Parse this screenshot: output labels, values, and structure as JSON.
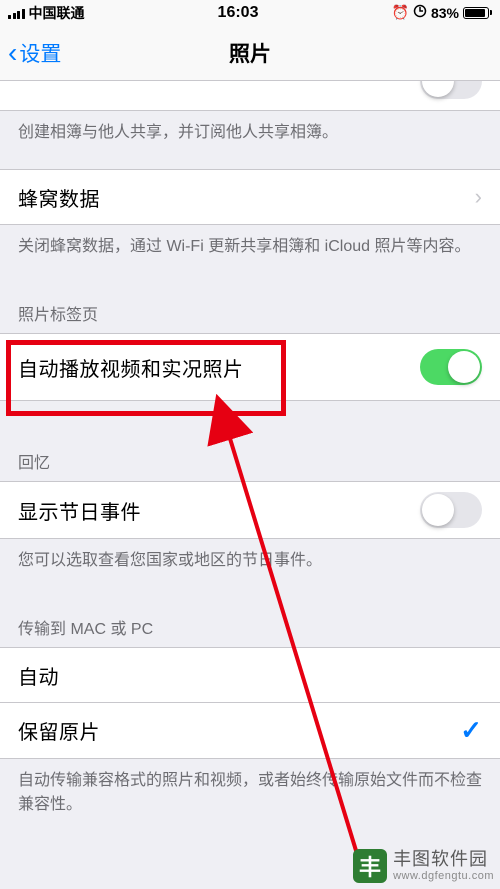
{
  "statusBar": {
    "carrier": "中国联通",
    "time": "16:03",
    "alarmIcon": "⏰",
    "rotationLockIcon": "⊕",
    "batteryPct": "83%"
  },
  "nav": {
    "back": "设置",
    "title": "照片"
  },
  "footers": {
    "sharedAlbums": "创建相簿与他人共享，并订阅他人共享相簿。",
    "cellular": "关闭蜂窝数据，通过 Wi-Fi 更新共享相簿和 iCloud 照片等内容。",
    "holidays": "您可以选取查看您国家或地区的节日事件。",
    "transfer": "自动传输兼容格式的照片和视频，或者始终传输原始文件而不检查兼容性。"
  },
  "headers": {
    "photoTabs": "照片标签页",
    "memories": "回忆",
    "transfer": "传输到 MAC 或 PC"
  },
  "cells": {
    "cellularData": "蜂窝数据",
    "autoplay": "自动播放视频和实况照片",
    "holidayEvents": "显示节日事件",
    "automatic": "自动",
    "keepOriginals": "保留原片"
  },
  "toggles": {
    "autoplayOn": true,
    "holidayEventsOn": false
  },
  "watermark": {
    "name": "丰图软件园",
    "url": "www.dgfengtu.com"
  }
}
